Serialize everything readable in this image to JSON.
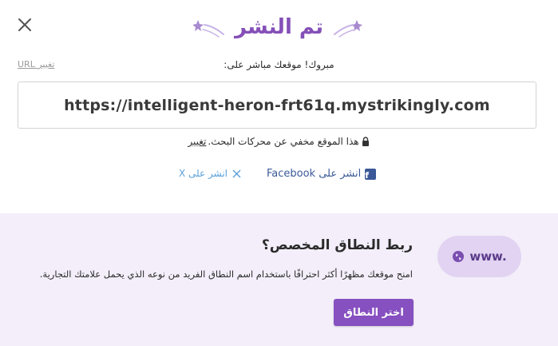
{
  "dialog": {
    "title": "تم النشر",
    "close_icon": "close-icon",
    "star_icon": "shooting-star-icon"
  },
  "url_section": {
    "change_url_label": "تغيير URL",
    "live_label": "مبروك! موقعك مباشر على:",
    "url": "https://intelligent-heron-frt61q.mystrikingly.com"
  },
  "visibility": {
    "lock_icon": "lock-icon",
    "text": "هذا الموقع مخفي عن محركات البحث.",
    "change_label": "تغيير"
  },
  "share": {
    "facebook_label": "انشر على Facebook",
    "facebook_icon": "facebook-icon",
    "x_label": "انشر على X",
    "x_icon": "x-icon"
  },
  "domain": {
    "badge_text": "www.",
    "globe_icon": "globe-icon",
    "title": "ربط النطاق المخصص؟",
    "description": "امنح موقعك مظهرًا أكثر احترافًا باستخدام اسم النطاق الفريد من نوعه الذي يحمل علامتك التجارية.",
    "button_label": "اختر النطاق"
  },
  "colors": {
    "accent": "#8450b7",
    "button": "#8650c0",
    "panel_bg": "#f3eefa",
    "badge_bg": "#e1d3f1",
    "facebook": "#3b5998",
    "x_link": "#5aa0d8"
  }
}
